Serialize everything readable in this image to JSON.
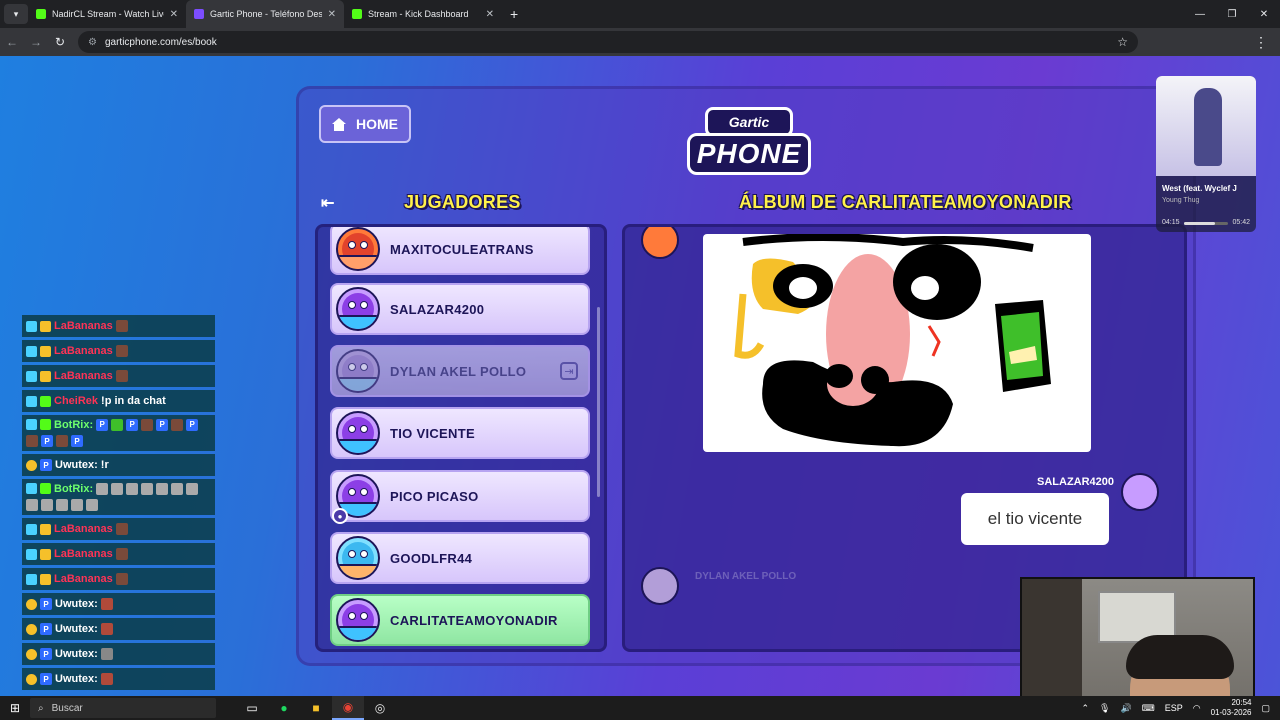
{
  "browser": {
    "tabs": [
      {
        "title": "NadirCL Stream - Watch Live o",
        "active": false
      },
      {
        "title": "Gartic Phone - Teléfono Descon",
        "active": true
      },
      {
        "title": "Stream - Kick Dashboard",
        "active": false
      }
    ],
    "new_tab": "+",
    "url": "garticphone.com/es/book"
  },
  "game": {
    "home_label": "HOME",
    "logo_top": "Gartic",
    "logo_bottom": "PHONE",
    "players_title": "JUGADORES",
    "album_title": "ÁLBUM DE CARLITATEAMOYONADIR",
    "players": [
      {
        "name": "MAXITOCULEATRANS",
        "state": "normal"
      },
      {
        "name": "SALAZAR4200",
        "state": "normal"
      },
      {
        "name": "DYLAN AKEL POLLO",
        "state": "inactive"
      },
      {
        "name": "TIO VICENTE",
        "state": "normal"
      },
      {
        "name": "PICO PICASO",
        "state": "normal"
      },
      {
        "name": "GOODLFR44",
        "state": "normal"
      },
      {
        "name": "CARLITATEAMOYONADIR",
        "state": "current"
      }
    ],
    "guess_author": "SALAZAR4200",
    "guess_text": "el tio vicente",
    "pending_player": "DYLAN AKEL POLLO"
  },
  "chat": {
    "messages": [
      {
        "user": "LaBananas",
        "text": "",
        "type": "mod"
      },
      {
        "user": "LaBananas",
        "text": "",
        "type": "mod"
      },
      {
        "user": "LaBananas",
        "text": "",
        "type": "mod"
      },
      {
        "user": "CheiRek",
        "text": "!p in da chat",
        "type": "mod"
      },
      {
        "user": "BotRix:",
        "text": "",
        "type": "bot"
      },
      {
        "user": "Uwutex:",
        "text": "!r",
        "type": "sub"
      },
      {
        "user": "BotRix:",
        "text": "",
        "type": "bot"
      },
      {
        "user": "LaBananas",
        "text": "",
        "type": "mod"
      },
      {
        "user": "LaBananas",
        "text": "",
        "type": "mod"
      },
      {
        "user": "LaBananas",
        "text": "",
        "type": "mod"
      },
      {
        "user": "Uwutex:",
        "text": "",
        "type": "sub"
      },
      {
        "user": "Uwutex:",
        "text": "",
        "type": "sub"
      },
      {
        "user": "Uwutex:",
        "text": "",
        "type": "sub"
      },
      {
        "user": "Uwutex:",
        "text": "",
        "type": "sub"
      }
    ]
  },
  "music": {
    "song": "West (feat. Wyclef J",
    "artist": "Young Thug",
    "elapsed": "04:15",
    "duration": "05:42",
    "progress": 0.7
  },
  "taskbar": {
    "search_placeholder": "Buscar",
    "lang": "ESP",
    "time": "20:54",
    "date": "01-03-2026"
  },
  "colors": {
    "title_yellow": "#fff14a",
    "current_player": "#9cf0ad",
    "kick_green": "#53fc18"
  }
}
